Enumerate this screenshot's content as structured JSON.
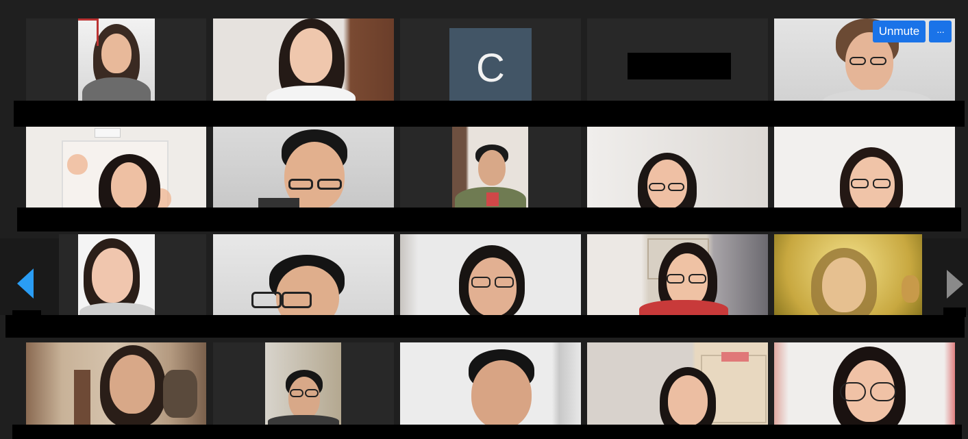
{
  "controls": {
    "unmute_label": "Unmute",
    "more_label": "···"
  },
  "participants": [
    {
      "avatar_letter": ""
    },
    {
      "avatar_letter": ""
    },
    {
      "avatar_letter": "C"
    },
    {
      "avatar_letter": ""
    },
    {
      "avatar_letter": ""
    }
  ],
  "navigation": {
    "prev_icon": "triangle-left-icon",
    "next_icon": "triangle-right-icon",
    "prev_color": "#2a9df4",
    "next_color": "#8a8a8a"
  },
  "colors": {
    "background": "#1f1f1f",
    "tile": "#282828",
    "avatar_bg": "#425566",
    "button_blue": "#1a73e8"
  }
}
